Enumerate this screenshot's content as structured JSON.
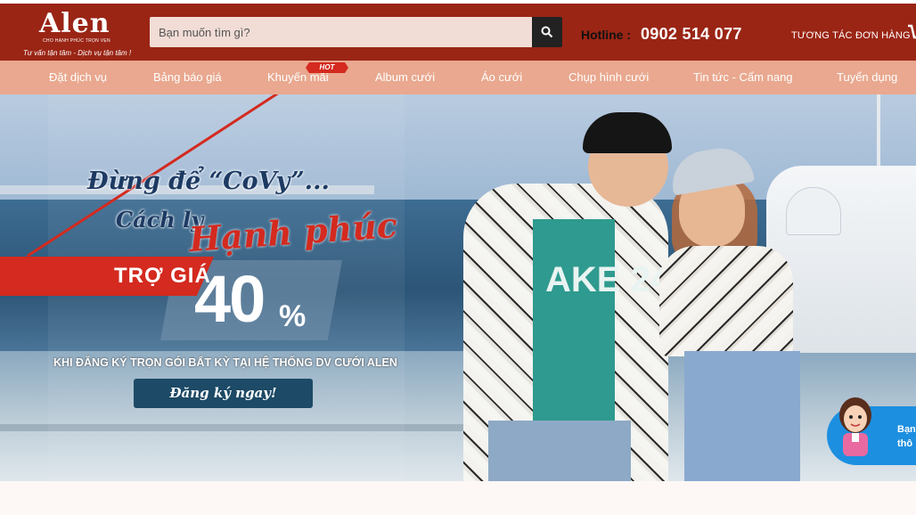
{
  "header": {
    "logo": {
      "word": "Alen",
      "sub": "CHO HẠNH PHÚC TRỌN VẸN",
      "slogan": "Tư vấn tận tâm - Dịch vụ tận tâm !"
    },
    "search": {
      "placeholder": "Bạn muốn tìm gì?"
    },
    "hotline_label": "Hotline :",
    "hotline_number": "0902 514 077",
    "order_tracking": "TƯƠNG TÁC ĐƠN HÀNG"
  },
  "nav": {
    "items": [
      {
        "label": "Đặt dịch vụ"
      },
      {
        "label": "Bảng báo giá"
      },
      {
        "label": "Khuyến mãi"
      },
      {
        "label": "Album cưới"
      },
      {
        "label": "Áo cưới"
      },
      {
        "label": "Chụp hình cưới"
      },
      {
        "label": "Tin tức - Cẩm nang"
      },
      {
        "label": "Tuyển dụng"
      }
    ],
    "hot_badge": "HOT"
  },
  "banner": {
    "line1": "Đừng để “CoVy”...",
    "line2": "Cách ly",
    "line3": "Hạnh phúc",
    "offer_label": "TRỢ GIÁ",
    "offer_value": "40",
    "offer_unit": "%",
    "condition": "KHI ĐĂNG KÝ TRỌN GÓI BẤT KỲ TẠI HỆ THỐNG DV CƯỚI ALEN",
    "cta": "Đăng ký ngay!",
    "tee_text": "AKE 24"
  },
  "assistant": {
    "line1": "Bạn",
    "line2": "thô"
  },
  "colors": {
    "header": "#9a2515",
    "nav": "#e9a88f",
    "accent_red": "#d42a1f",
    "cta_blue": "#1d4a66"
  }
}
